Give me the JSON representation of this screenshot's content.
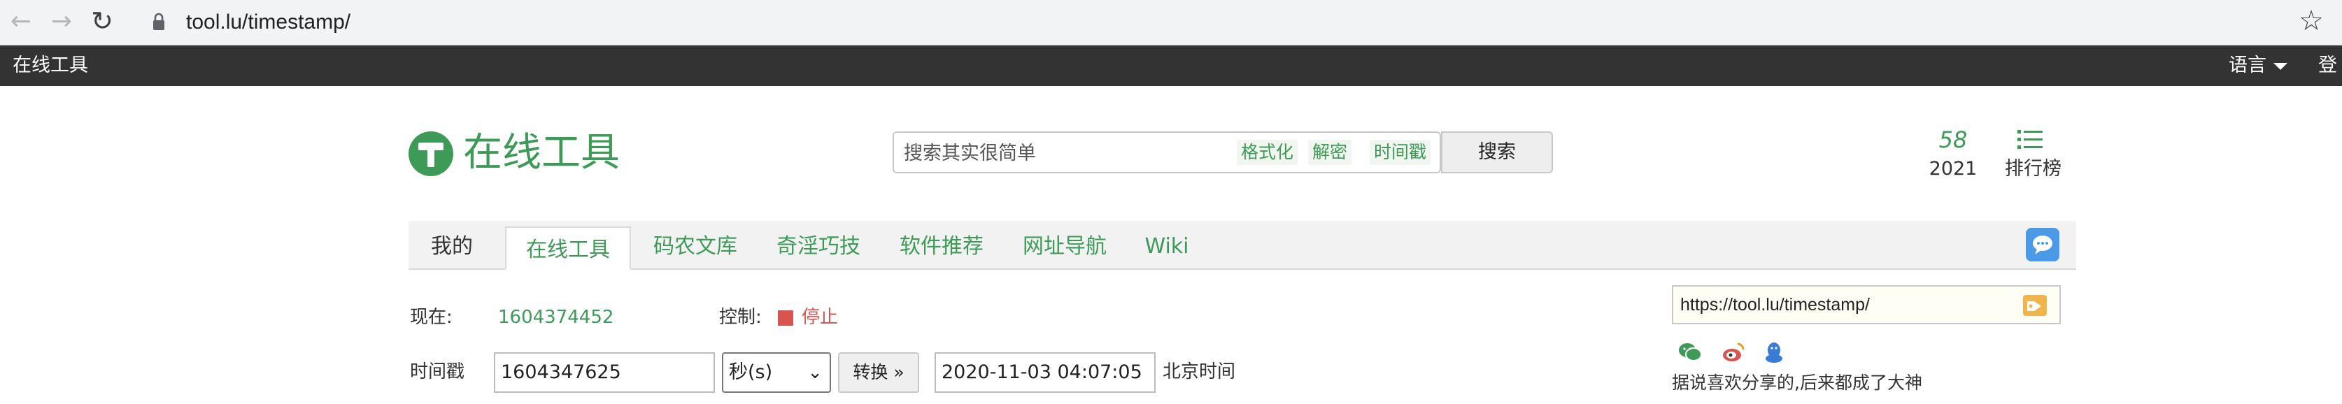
{
  "browser": {
    "url": "tool.lu/timestamp/"
  },
  "topbar": {
    "brand": "在线工具",
    "language": "语言",
    "login": "登"
  },
  "header": {
    "logo_text": "在线工具",
    "search": {
      "placeholder": "搜索其实很简单",
      "tags": [
        "格式化",
        "解密",
        "时间戳"
      ],
      "button": "搜索"
    },
    "stat": {
      "number": "58",
      "year": "2021"
    },
    "rank_label": "排行榜"
  },
  "nav": {
    "tabs": [
      "我的",
      "在线工具",
      "码农文库",
      "奇淫巧技",
      "软件推荐",
      "网址导航",
      "Wiki"
    ],
    "active_tab": "在线工具"
  },
  "now_row": {
    "label": "现在:",
    "value": "1604374452",
    "control_label": "控制:",
    "control_value": "停止"
  },
  "convert_row": {
    "label": "时间戳",
    "timestamp_value": "1604347625",
    "unit": "秒(s)",
    "convert_button": "转换",
    "result_value": "2020-11-03 04:07:05",
    "timezone": "北京时间"
  },
  "share": {
    "url": "https://tool.lu/timestamp/",
    "note": "据说喜欢分享的,后来都成了大神",
    "icons": [
      "wechat-icon",
      "weibo-icon",
      "qq-icon"
    ]
  },
  "colors": {
    "brand_green": "#3d9a57",
    "topbar_bg": "#333333",
    "stop_red": "#d9534f",
    "chat_blue": "#4a9ae8"
  }
}
